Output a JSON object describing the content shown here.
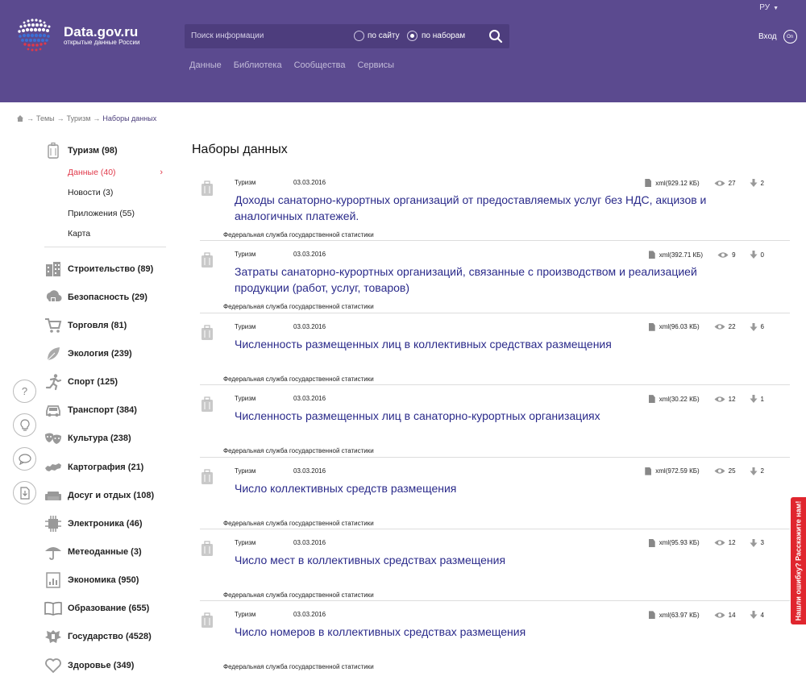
{
  "header": {
    "lang": "РУ",
    "logo_title": "Data.gov.ru",
    "logo_subtitle": "открытые данные России",
    "search_placeholder": "Поиск информации",
    "radio_site": "по сайту",
    "radio_sets": "по наборам",
    "nav": [
      "Данные",
      "Библиотека",
      "Сообщества",
      "Сервисы"
    ],
    "login": "Вход",
    "login_icon_text": "On"
  },
  "breadcrumb": {
    "items": [
      "Темы",
      "Туризм"
    ],
    "current": "Наборы данных",
    "separator": "→"
  },
  "sidebar": {
    "main_topic": {
      "label": "Туризм (98)",
      "icon": "suitcase-icon"
    },
    "subitems": [
      {
        "label": "Данные (40)",
        "active": true
      },
      {
        "label": "Новости (3)",
        "active": false
      },
      {
        "label": "Приложения (55)",
        "active": false
      },
      {
        "label": "Карта",
        "active": false
      }
    ],
    "categories": [
      {
        "label": "Строительство (89)",
        "icon": "building-icon"
      },
      {
        "label": "Безопасность (29)",
        "icon": "lock-cloud-icon"
      },
      {
        "label": "Торговля (81)",
        "icon": "cart-icon"
      },
      {
        "label": "Экология (239)",
        "icon": "leaf-icon"
      },
      {
        "label": "Спорт (125)",
        "icon": "runner-icon"
      },
      {
        "label": "Транспорт (384)",
        "icon": "car-icon"
      },
      {
        "label": "Культура (238)",
        "icon": "masks-icon"
      },
      {
        "label": "Картография (21)",
        "icon": "map-icon"
      },
      {
        "label": "Досуг и отдых (108)",
        "icon": "sofa-icon"
      },
      {
        "label": "Электроника (46)",
        "icon": "chip-icon"
      },
      {
        "label": "Метеоданные (3)",
        "icon": "umbrella-icon"
      },
      {
        "label": "Экономика (950)",
        "icon": "chart-doc-icon"
      },
      {
        "label": "Образование (655)",
        "icon": "book-icon"
      },
      {
        "label": "Государство (4528)",
        "icon": "emblem-icon"
      },
      {
        "label": "Здоровье (349)",
        "icon": "heart-icon"
      }
    ]
  },
  "tools": [
    {
      "name": "help-icon",
      "glyph": "?"
    },
    {
      "name": "idea-icon",
      "glyph": "💡"
    },
    {
      "name": "chat-icon",
      "glyph": "💬"
    },
    {
      "name": "download-doc-icon",
      "glyph": "⇩"
    }
  ],
  "main": {
    "title": "Наборы данных",
    "datasets": [
      {
        "topic": "Туризм",
        "date": "03.03.2016",
        "title": "Доходы санаторно-курортных организаций от предоставляемых услуг без НДС, акцизов и аналогичных платежей.",
        "org": "Федеральная служба государственной статистики",
        "file": "xml(929.12 КБ)",
        "views": "27",
        "downloads": "2"
      },
      {
        "topic": "Туризм",
        "date": "03.03.2016",
        "title": "Затраты санаторно-курортных организаций, связанные с производством и реализацией продукции (работ, услуг, товаров)",
        "org": "Федеральная служба государственной статистики",
        "file": "xml(392.71 КБ)",
        "views": "9",
        "downloads": "0"
      },
      {
        "topic": "Туризм",
        "date": "03.03.2016",
        "title": "Численность размещенных лиц в коллективных средствах размещения",
        "org": "Федеральная служба государственной статистики",
        "file": "xml(96.03 КБ)",
        "views": "22",
        "downloads": "6"
      },
      {
        "topic": "Туризм",
        "date": "03.03.2016",
        "title": "Численность размещенных лиц в санаторно-курортных организациях",
        "org": "Федеральная служба государственной статистики",
        "file": "xml(30.22 КБ)",
        "views": "12",
        "downloads": "1"
      },
      {
        "topic": "Туризм",
        "date": "03.03.2016",
        "title": "Число коллективных средств размещения",
        "org": "Федеральная служба государственной статистики",
        "file": "xml(972.59 КБ)",
        "views": "25",
        "downloads": "2"
      },
      {
        "topic": "Туризм",
        "date": "03.03.2016",
        "title": "Число мест в коллективных средствах размещения",
        "org": "Федеральная служба государственной статистики",
        "file": "xml(95.93 КБ)",
        "views": "12",
        "downloads": "3"
      },
      {
        "topic": "Туризм",
        "date": "03.03.2016",
        "title": "Число номеров в коллективных средствах размещения",
        "org": "Федеральная служба государственной статистики",
        "file": "xml(63.97 КБ)",
        "views": "14",
        "downloads": "4"
      }
    ]
  },
  "feedback": "Нашли ошибку? Расскажите нам!",
  "colors": {
    "header_bg": "#5b4a8f",
    "search_bg": "#4d3d7d",
    "link_title": "#2a2a8a",
    "active_red": "#e0394a",
    "feedback_red": "#e0262e"
  }
}
